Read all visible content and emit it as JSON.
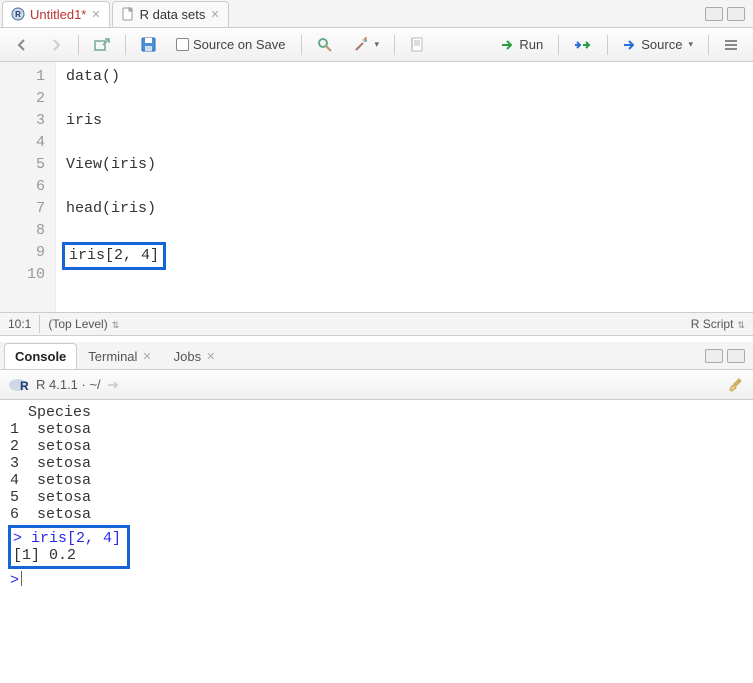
{
  "editor_tabs": [
    {
      "label": "Untitled1*",
      "active": true
    },
    {
      "label": "R data sets",
      "active": false
    }
  ],
  "toolbar": {
    "source_on_save": "Source on Save",
    "run": "Run",
    "source_btn": "Source"
  },
  "code_lines": [
    "data()",
    "",
    "iris",
    "",
    "View(iris)",
    "",
    "head(iris)",
    "",
    "iris[2, 4]",
    ""
  ],
  "highlighted_code_line_index": 8,
  "statusbar": {
    "cursor_pos": "10:1",
    "scope": "(Top Level)",
    "filetype": "R Script"
  },
  "console_tabs": [
    {
      "label": "Console",
      "active": true
    },
    {
      "label": "Terminal",
      "active": false,
      "closable": true
    },
    {
      "label": "Jobs",
      "active": false,
      "closable": true
    }
  ],
  "console_info": "R 4.1.1 · ~/",
  "console_output": {
    "header_line": "  Species",
    "rows": [
      {
        "n": "1",
        "val": "setosa"
      },
      {
        "n": "2",
        "val": "setosa"
      },
      {
        "n": "3",
        "val": "setosa"
      },
      {
        "n": "4",
        "val": "setosa"
      },
      {
        "n": "5",
        "val": "setosa"
      },
      {
        "n": "6",
        "val": "setosa"
      }
    ],
    "highlight": {
      "prompt_line": "> iris[2, 4]",
      "result_line": "[1] 0.2"
    },
    "trailing_prompt": ">"
  }
}
